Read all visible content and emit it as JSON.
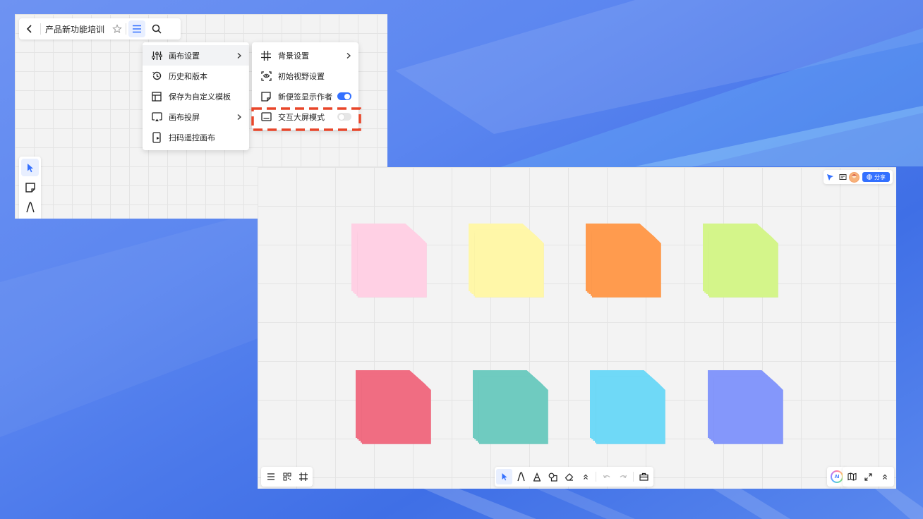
{
  "top_window": {
    "title": "产品新功能培训",
    "main_menu": [
      {
        "label": "画布设置",
        "icon": "sliders-icon",
        "has_submenu": true
      },
      {
        "label": "历史和版本",
        "icon": "history-icon",
        "has_submenu": false
      },
      {
        "label": "保存为自定义模板",
        "icon": "template-icon",
        "has_submenu": false
      },
      {
        "label": "画布投屏",
        "icon": "cast-icon",
        "has_submenu": true
      },
      {
        "label": "扫码遥控画布",
        "icon": "remote-icon",
        "has_submenu": false
      }
    ],
    "sub_menu": [
      {
        "label": "背景设置",
        "icon": "grid-icon",
        "has_submenu": true
      },
      {
        "label": "初始视野设置",
        "icon": "eye-frame-icon"
      },
      {
        "label": "新便签显示作者",
        "icon": "sticky-icon",
        "toggle": "on"
      },
      {
        "label": "交互大屏模式",
        "icon": "keyboard-icon",
        "toggle": "off"
      }
    ]
  },
  "main_window": {
    "share_label": "分享",
    "ai_label": "AI",
    "sticky_colors": [
      "#ffd0e4",
      "#fff7a8",
      "#ff9b4e",
      "#d4f58a",
      "#f06d82",
      "#6fcbc0",
      "#6fd9f7",
      "#8497fb"
    ]
  },
  "colors": {
    "accent": "#3370ff",
    "highlight": "#e8462a"
  }
}
